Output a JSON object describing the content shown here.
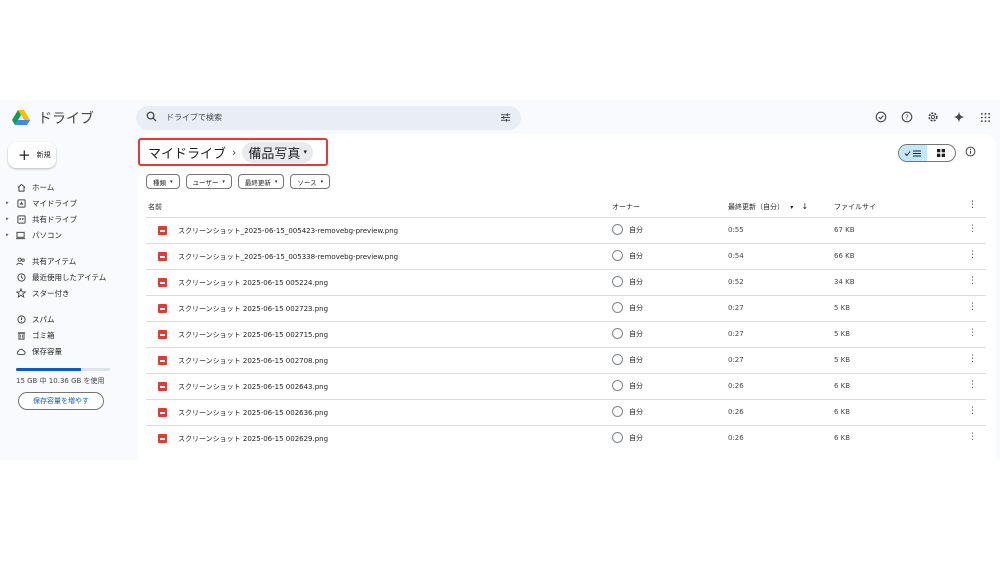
{
  "app": {
    "name": "ドライブ"
  },
  "search": {
    "placeholder": "ドライブで検索"
  },
  "sidebar": {
    "new_label": "新規",
    "items": [
      {
        "label": "ホーム",
        "icon": "home-icon"
      },
      {
        "label": "マイドライブ",
        "icon": "my-drive-icon"
      },
      {
        "label": "共有ドライブ",
        "icon": "shared-drive-icon"
      },
      {
        "label": "パソコン",
        "icon": "computer-icon"
      },
      {
        "label": "共有アイテム",
        "icon": "shared-people-icon"
      },
      {
        "label": "最近使用したアイテム",
        "icon": "clock-icon"
      },
      {
        "label": "スター付き",
        "icon": "star-icon"
      },
      {
        "label": "スパム",
        "icon": "spam-icon"
      },
      {
        "label": "ゴミ箱",
        "icon": "trash-icon"
      },
      {
        "label": "保存容量",
        "icon": "cloud-icon"
      }
    ],
    "storage": {
      "text": "15 GB 中 10.36 GB を使用",
      "used_fraction": 0.69,
      "button": "保存容量を増やす"
    }
  },
  "breadcrumb": {
    "root": "マイドライブ",
    "separator": "›",
    "current": "備品写真"
  },
  "filters": [
    "種類",
    "ユーザー",
    "最終更新",
    "ソース"
  ],
  "table": {
    "headers": {
      "name": "名前",
      "owner": "オーナー",
      "modified": "最終更新（自分）",
      "size": "ファイルサイ"
    },
    "rows": [
      {
        "name": "スクリーンショット_2025-06-15_005423-removebg-preview.png",
        "owner": "自分",
        "modified": "0:55",
        "size": "67 KB"
      },
      {
        "name": "スクリーンショット_2025-06-15_005338-removebg-preview.png",
        "owner": "自分",
        "modified": "0:54",
        "size": "66 KB"
      },
      {
        "name": "スクリーンショット 2025-06-15 005224.png",
        "owner": "自分",
        "modified": "0:52",
        "size": "34 KB"
      },
      {
        "name": "スクリーンショット 2025-06-15 002723.png",
        "owner": "自分",
        "modified": "0:27",
        "size": "5 KB"
      },
      {
        "name": "スクリーンショット 2025-06-15 002715.png",
        "owner": "自分",
        "modified": "0:27",
        "size": "5 KB"
      },
      {
        "name": "スクリーンショット 2025-06-15 002708.png",
        "owner": "自分",
        "modified": "0:27",
        "size": "5 KB"
      },
      {
        "name": "スクリーンショット 2025-06-15 002643.png",
        "owner": "自分",
        "modified": "0:26",
        "size": "6 KB"
      },
      {
        "name": "スクリーンショット 2025-06-15 002636.png",
        "owner": "自分",
        "modified": "0:26",
        "size": "6 KB"
      },
      {
        "name": "スクリーンショット 2025-06-15 002629.png",
        "owner": "自分",
        "modified": "0:26",
        "size": "6 KB"
      }
    ]
  },
  "colors": {
    "accent": "#0b57d0",
    "highlight_box": "#e53935",
    "selected_view": "#c2e7ff"
  }
}
